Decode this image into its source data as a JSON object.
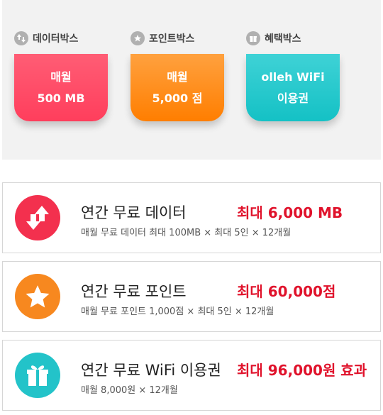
{
  "boxes": [
    {
      "label": "데이터박스",
      "line1": "매월",
      "line2": "500 MB",
      "icon": "data-arrows-icon",
      "color": "#ff4964"
    },
    {
      "label": "포인트박스",
      "line1": "매월",
      "line2": "5,000 점",
      "icon": "star-icon",
      "color": "#ff8c16"
    },
    {
      "label": "혜택박스",
      "line1": "olleh WiFi",
      "line2": "이용권",
      "icon": "gift-icon",
      "color": "#1fc6ca"
    }
  ],
  "rows": [
    {
      "title": "연간 무료 데이터",
      "max": "최대 6,000 MB",
      "desc": "매월 무료 데이터 최대 100MB × 최대 5인 × 12개월",
      "icon": "data-arrows-icon"
    },
    {
      "title": "연간 무료 포인트",
      "max": "최대 60,000점",
      "desc": "매월 무료 포인트 1,000점 × 최대 5인 × 12개월",
      "icon": "star-icon"
    },
    {
      "title": "연간 무료 WiFi 이용권",
      "max": "최대 96,000원 효과",
      "desc": "매월 8,000원 × 12개월",
      "icon": "gift-icon"
    }
  ]
}
